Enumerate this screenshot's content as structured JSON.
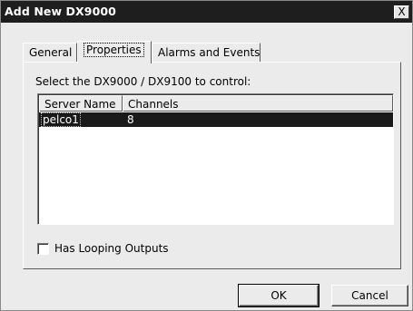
{
  "window": {
    "title": "Add New DX9000",
    "close_label": "X"
  },
  "tabs": [
    {
      "label": "General",
      "active": false
    },
    {
      "label": "Properties",
      "active": true
    },
    {
      "label": "Alarms and Events",
      "active": false
    }
  ],
  "properties": {
    "instruction": "Select the DX9000 / DX9100 to control:",
    "columns": [
      "Server Name",
      "Channels"
    ],
    "rows": [
      {
        "server_name": "pelco1",
        "channels": "8",
        "selected": true
      }
    ],
    "looping_outputs": {
      "label": "Has Looping Outputs",
      "checked": false
    }
  },
  "buttons": {
    "ok_label": "OK",
    "cancel_label": "Cancel"
  }
}
